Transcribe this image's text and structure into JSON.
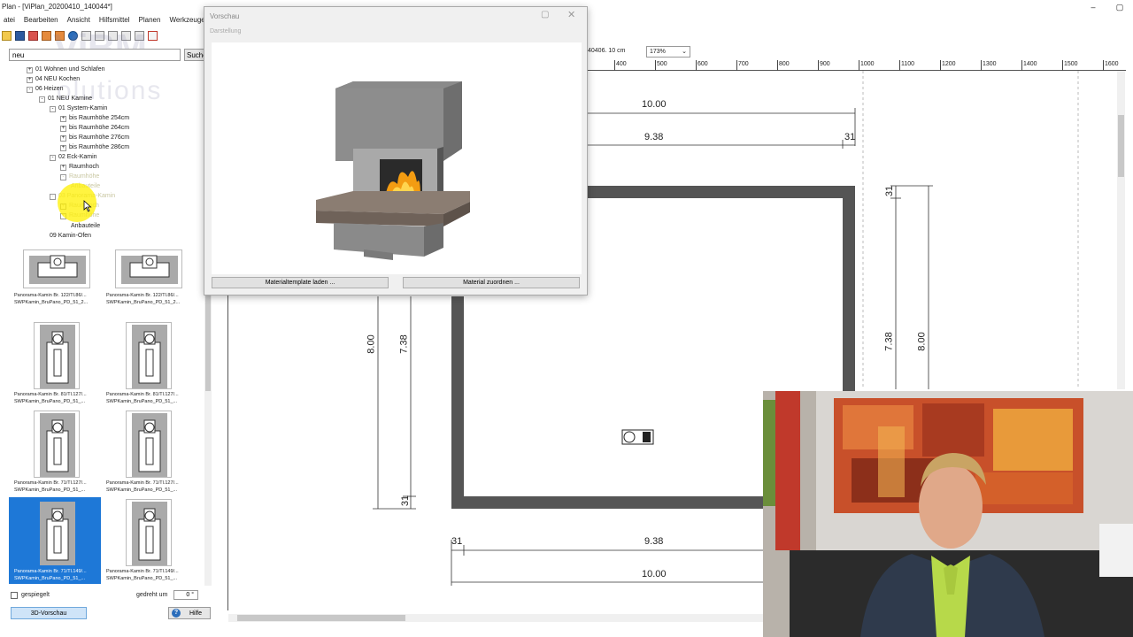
{
  "window": {
    "title": "Plan - [ViPlan_20200410_140044*]",
    "controls": [
      "–",
      "▢"
    ]
  },
  "menu": [
    "atei",
    "Bearbeiten",
    "Ansicht",
    "Hilfsmittel",
    "Planen",
    "Werkzeuge"
  ],
  "watermark": {
    "line1": "ViBM",
    "line2": "olutions"
  },
  "search": {
    "value": "neu",
    "button_label": "Suche"
  },
  "tree": [
    {
      "label": "01 Wohnen und Schlafen",
      "exp": "+",
      "faded": false
    },
    {
      "label": "04 NEU Kochen",
      "exp": "+",
      "faded": false
    },
    {
      "label": "06 Heizen",
      "exp": "-",
      "faded": false
    },
    {
      "label": "01 NEU Kamine",
      "exp": "-",
      "faded": false
    },
    {
      "label": "01 System-Kamin",
      "exp": "-",
      "faded": false
    },
    {
      "label": "bis Raumhöhe 254cm",
      "exp": "+",
      "faded": false
    },
    {
      "label": "bis Raumhöhe 264cm",
      "exp": "+",
      "faded": false
    },
    {
      "label": "bis Raumhöhe 276cm",
      "exp": "+",
      "faded": false
    },
    {
      "label": "bis Raumhöhe 286cm",
      "exp": "+",
      "faded": false
    },
    {
      "label": "02 Eck-Kamin",
      "exp": "-",
      "faded": false
    },
    {
      "label": "Raumhoch",
      "exp": "+",
      "faded": false
    },
    {
      "label": "Raumhöhe",
      "exp": "-",
      "faded": true
    },
    {
      "label": "Anbauteile",
      "exp": "",
      "faded": true
    },
    {
      "label": "03 Panorama-Kamin",
      "exp": "-",
      "faded": true
    },
    {
      "label": "Raumhoch",
      "exp": "+",
      "faded": true
    },
    {
      "label": "Raumhöhe",
      "exp": "+",
      "faded": true
    },
    {
      "label": "Anbauteile",
      "exp": "",
      "faded": false
    },
    {
      "label": "09 Kamin-Ofen",
      "exp": "",
      "faded": false
    }
  ],
  "thumbnails": [
    {
      "line1": "Panorama-Kamin Br. 122/Tl.86/...",
      "line2": "SWPKamin_BruPano_PD_51_2...",
      "selected": false
    },
    {
      "line1": "Panorama-Kamin Br. 122/Tl.86/...",
      "line2": "SWPKamin_BruPano_PD_51_2...",
      "selected": false
    },
    {
      "line1": "Panorama-Kamin Br. 81/Tl.127/...",
      "line2": "SWPKamin_BruPano_PD_51_...",
      "selected": false
    },
    {
      "line1": "Panorama-Kamin Br. 81/Tl.127/...",
      "line2": "SWPKamin_BruPano_PD_51_...",
      "selected": false
    },
    {
      "line1": "Panorama-Kamin Br. 71/Tl.127/...",
      "line2": "SWPKamin_BruPano_PD_51_...",
      "selected": false
    },
    {
      "line1": "Panorama-Kamin Br. 71/Tl.127/...",
      "line2": "SWPKamin_BruPano_PD_51_...",
      "selected": false
    },
    {
      "line1": "Panorama-Kamin Br. 71/Tl.149/...",
      "line2": "SWPKamin_BruPano_PD_51_...",
      "selected": true
    },
    {
      "line1": "Panorama-Kamin Br. 71/Tl.149/...",
      "line2": "SWPKamin_BruPano_PD_51_...",
      "selected": false
    }
  ],
  "options": {
    "mirrored_label": "gespiegelt",
    "rotated_label": "gedreht um",
    "rotation_value": "0 °",
    "preview_button": "3D-Vorschau",
    "help_button": "Hilfe"
  },
  "drawing": {
    "coord_readout": "40406. 10 cm",
    "zoom": "173%",
    "ruler_ticks": [
      "400",
      "500",
      "600",
      "700",
      "800",
      "900",
      "1000",
      "1100",
      "1200",
      "1300",
      "1400",
      "1500",
      "1600"
    ],
    "dims": {
      "top_outer": "10.00",
      "top_inner": "9.38",
      "top_right": "31",
      "right_small": "31",
      "left_outer": "8.00",
      "left_inner": "7.38",
      "left_small": "31",
      "right_inner": "7.38",
      "right_outer": "8.00",
      "bottom_left": "31",
      "bottom_inner": "9.38",
      "bottom_outer": "10.00"
    }
  },
  "dialog": {
    "title": "Vorschau",
    "subtitle": "Darstellung",
    "template_button": "Materialtemplate laden ...",
    "material_button": "Material zuordnen ..."
  }
}
